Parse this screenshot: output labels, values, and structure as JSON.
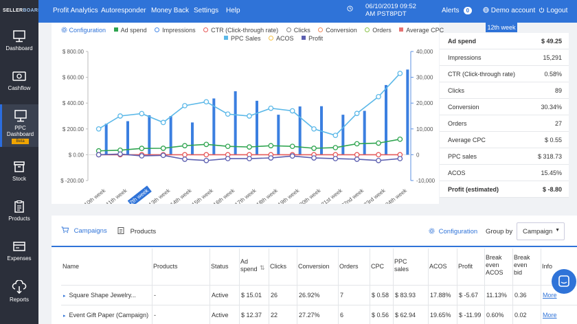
{
  "brand": {
    "part1": "SELLER",
    "part2": "BOARD"
  },
  "sidebar": {
    "items": [
      {
        "label": "Dashboard",
        "icon": "monitor-icon"
      },
      {
        "label": "Cashflow",
        "icon": "cash-icon"
      },
      {
        "label": "PPC Dashboard",
        "icon": "ppc-monitor-icon",
        "badge": "Beta"
      },
      {
        "label": "Stock",
        "icon": "box-icon"
      },
      {
        "label": "Products",
        "icon": "clipboard-icon"
      },
      {
        "label": "Expenses",
        "icon": "card-icon"
      },
      {
        "label": "Reports",
        "icon": "cloud-icon"
      }
    ]
  },
  "topbar": {
    "nav": [
      "Profit Analytics",
      "Autoresponder",
      "Money Back",
      "Settings",
      "Help"
    ],
    "datetime": "06/10/2019 09:52 AM PST8PDT",
    "alerts_label": "Alerts",
    "alerts_count": "0",
    "account_label": "Demo account",
    "logout_label": "Logout"
  },
  "legend": {
    "configuration": "Configuration",
    "items": [
      {
        "label": "Ad spend",
        "color": "#2ea44f",
        "shape": "square"
      },
      {
        "label": "Impressions",
        "color": "#4a8be8",
        "shape": "circle"
      },
      {
        "label": "CTR (Click-through rate)",
        "color": "#e65a5a",
        "shape": "circle"
      },
      {
        "label": "Clicks",
        "color": "#888888",
        "shape": "circle"
      },
      {
        "label": "Conversion",
        "color": "#f08a5d",
        "shape": "circle"
      },
      {
        "label": "Orders",
        "color": "#8bc34a",
        "shape": "circle"
      },
      {
        "label": "Average CPC",
        "color": "#e57373",
        "shape": "square"
      }
    ],
    "items2": [
      {
        "label": "PPC Sales",
        "color": "#5bb8e8",
        "shape": "square"
      },
      {
        "label": "ACOS",
        "color": "#f5c242",
        "shape": "circle"
      },
      {
        "label": "Profit",
        "color": "#5c5fb0",
        "shape": "square"
      }
    ]
  },
  "chart_data": {
    "type": "line",
    "categories": [
      "10th week",
      "11th week",
      "12th week",
      "13th week",
      "14th week",
      "15th week",
      "16th week",
      "17th week",
      "18th week",
      "19th week",
      "20th week",
      "21st week",
      "22nd week",
      "23rd week",
      "24th week"
    ],
    "y_left_ticks": [
      "$ 800.00",
      "$ 600.00",
      "$ 400.00",
      "$ 200.00",
      "$ 0.00",
      "$ -200.00"
    ],
    "y_right_ticks": [
      "40,000",
      "30,000",
      "20,000",
      "10,000",
      "0",
      "-10,000"
    ],
    "ylim_left": [
      -200,
      800
    ],
    "ylim_right": [
      -10000,
      40000
    ],
    "highlighted_category": "12th week",
    "series": [
      {
        "name": "Impressions",
        "axis": "right",
        "type": "bars",
        "color": "#3b7fe0",
        "values": [
          12000,
          13000,
          15291,
          15000,
          12500,
          21800,
          24600,
          20900,
          15500,
          18700,
          18800,
          15500,
          17000,
          27000,
          33000
        ]
      },
      {
        "name": "PPC Sales",
        "axis": "left",
        "type": "line",
        "color": "#5bb8e8",
        "values": [
          200,
          300,
          318.73,
          250,
          380,
          410,
          315,
          300,
          360,
          340,
          200,
          150,
          320,
          450,
          630
        ]
      },
      {
        "name": "Ad spend",
        "axis": "left",
        "type": "line",
        "color": "#2ea44f",
        "values": [
          30,
          35,
          49.25,
          50,
          70,
          80,
          65,
          60,
          70,
          65,
          50,
          55,
          85,
          90,
          120
        ]
      },
      {
        "name": "CTR (Click-through rate)",
        "axis": "left",
        "type": "line",
        "color": "#e65a5a",
        "values": [
          0,
          0,
          0,
          0,
          0,
          0,
          0,
          0,
          0,
          0,
          0,
          0,
          0,
          0,
          0
        ]
      },
      {
        "name": "Profit",
        "axis": "left",
        "type": "line",
        "color": "#5c5fb0",
        "values": [
          0,
          5,
          -8.8,
          -5,
          -35,
          -45,
          -30,
          -30,
          -25,
          -10,
          -25,
          -30,
          -35,
          -45,
          -30
        ]
      }
    ]
  },
  "stats_header": "12th week",
  "stats": [
    {
      "label": "Ad spend",
      "value": "$ 49.25",
      "bold": true
    },
    {
      "label": "Impressions",
      "value": "15,291"
    },
    {
      "label": "CTR (Click-through rate)",
      "value": "0.58%"
    },
    {
      "label": "Clicks",
      "value": "89"
    },
    {
      "label": "Conversion",
      "value": "30.34%"
    },
    {
      "label": "Orders",
      "value": "27"
    },
    {
      "label": "Average CPC",
      "value": "$ 0.55"
    },
    {
      "label": "PPC sales",
      "value": "$ 318.73"
    },
    {
      "label": "ACOS",
      "value": "15.45%"
    },
    {
      "label": "Profit (estimated)",
      "value": "$ -8.80",
      "bold": true
    }
  ],
  "bottom": {
    "tab_campaigns": "Campaigns",
    "tab_products": "Products",
    "configuration": "Configuration",
    "group_by_label": "Group by",
    "group_by_value": "Campaign",
    "headers": [
      "Name",
      "Products",
      "Status",
      "Ad\nspend",
      "Clicks",
      "Conversion",
      "Orders",
      "CPC",
      "PPC\nsales",
      "ACOS",
      "Profit",
      "Break\neven\nACOS",
      "Break\neven\nbid",
      "Info"
    ],
    "rows": [
      [
        "Square Shape Jewelry...",
        "-",
        "Active",
        "$ 15.01",
        "26",
        "26.92%",
        "7",
        "$ 0.58",
        "$ 83.93",
        "17.88%",
        "$ -5.67",
        "11.13%",
        "0.36",
        "More"
      ],
      [
        "Event Gift Paper (Campaign)",
        "-",
        "Active",
        "$ 12.37",
        "22",
        "27.27%",
        "6",
        "$ 0.56",
        "$ 62.94",
        "19.65%",
        "$ -11.99",
        "0.60%",
        "0.02",
        "More"
      ]
    ]
  }
}
